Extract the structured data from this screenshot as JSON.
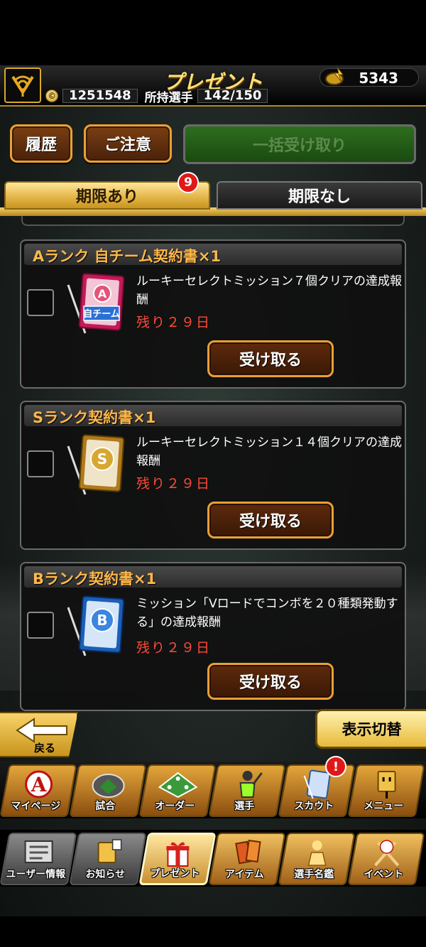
{
  "header": {
    "title": "プレゼント",
    "gems": "5343",
    "money": "1251548",
    "coin_symbol": "©",
    "owned_label": "所持選手",
    "owned_value": "142/150"
  },
  "actions": {
    "history": "履歴",
    "notice": "ご注意",
    "receive_all": "一括受け取り"
  },
  "tabs": [
    {
      "label": "期限あり",
      "active": true,
      "badge": "9"
    },
    {
      "label": "期限なし",
      "active": false
    }
  ],
  "presents": [
    {
      "title": "Aランク 自チーム契約書×1",
      "icon": "a-rank-contract-icon",
      "icon_letter": "A",
      "icon_text": "自チーム",
      "description": "ルーキーセレクトミッション７個クリアの達成報酬",
      "remaining": "残り２９日",
      "button": "受け取る"
    },
    {
      "title": "Sランク契約書×1",
      "icon": "s-rank-contract-icon",
      "icon_letter": "S",
      "description": "ルーキーセレクトミッション１４個クリアの達成報酬",
      "remaining": "残り２９日",
      "button": "受け取る"
    },
    {
      "title": "Bランク契約書×1",
      "icon": "b-rank-contract-icon",
      "icon_letter": "B",
      "description": "ミッション「Vロードでコンボを２０種類発動する」の達成報酬",
      "remaining": "残り２９日",
      "button": "受け取る"
    }
  ],
  "bottom": {
    "back": "戻る",
    "switch_view": "表示切替"
  },
  "nav_main": [
    {
      "label": "マイページ",
      "icon": "a-logo-icon"
    },
    {
      "label": "試合",
      "icon": "stadium-icon"
    },
    {
      "label": "オーダー",
      "icon": "field-order-icon"
    },
    {
      "label": "選手",
      "icon": "batter-icon"
    },
    {
      "label": "スカウト",
      "icon": "scout-card-icon",
      "alert": "!"
    },
    {
      "label": "メニュー",
      "icon": "menu-character-icon"
    }
  ],
  "nav_sub": [
    {
      "label": "ユーザー情報",
      "icon": "user-info-icon"
    },
    {
      "label": "お知らせ",
      "icon": "notice-icon"
    },
    {
      "label": "プレゼント",
      "icon": "gift-icon"
    },
    {
      "label": "アイテム",
      "icon": "item-icon"
    },
    {
      "label": "選手名鑑",
      "icon": "player-directory-icon"
    },
    {
      "label": "イベント",
      "icon": "baseball-event-icon"
    }
  ],
  "colors": {
    "accent_gold": "#e2b345",
    "title_orange": "#ffb84a",
    "remaining_red": "#ff4a3a",
    "badge_red": "#e01818"
  }
}
